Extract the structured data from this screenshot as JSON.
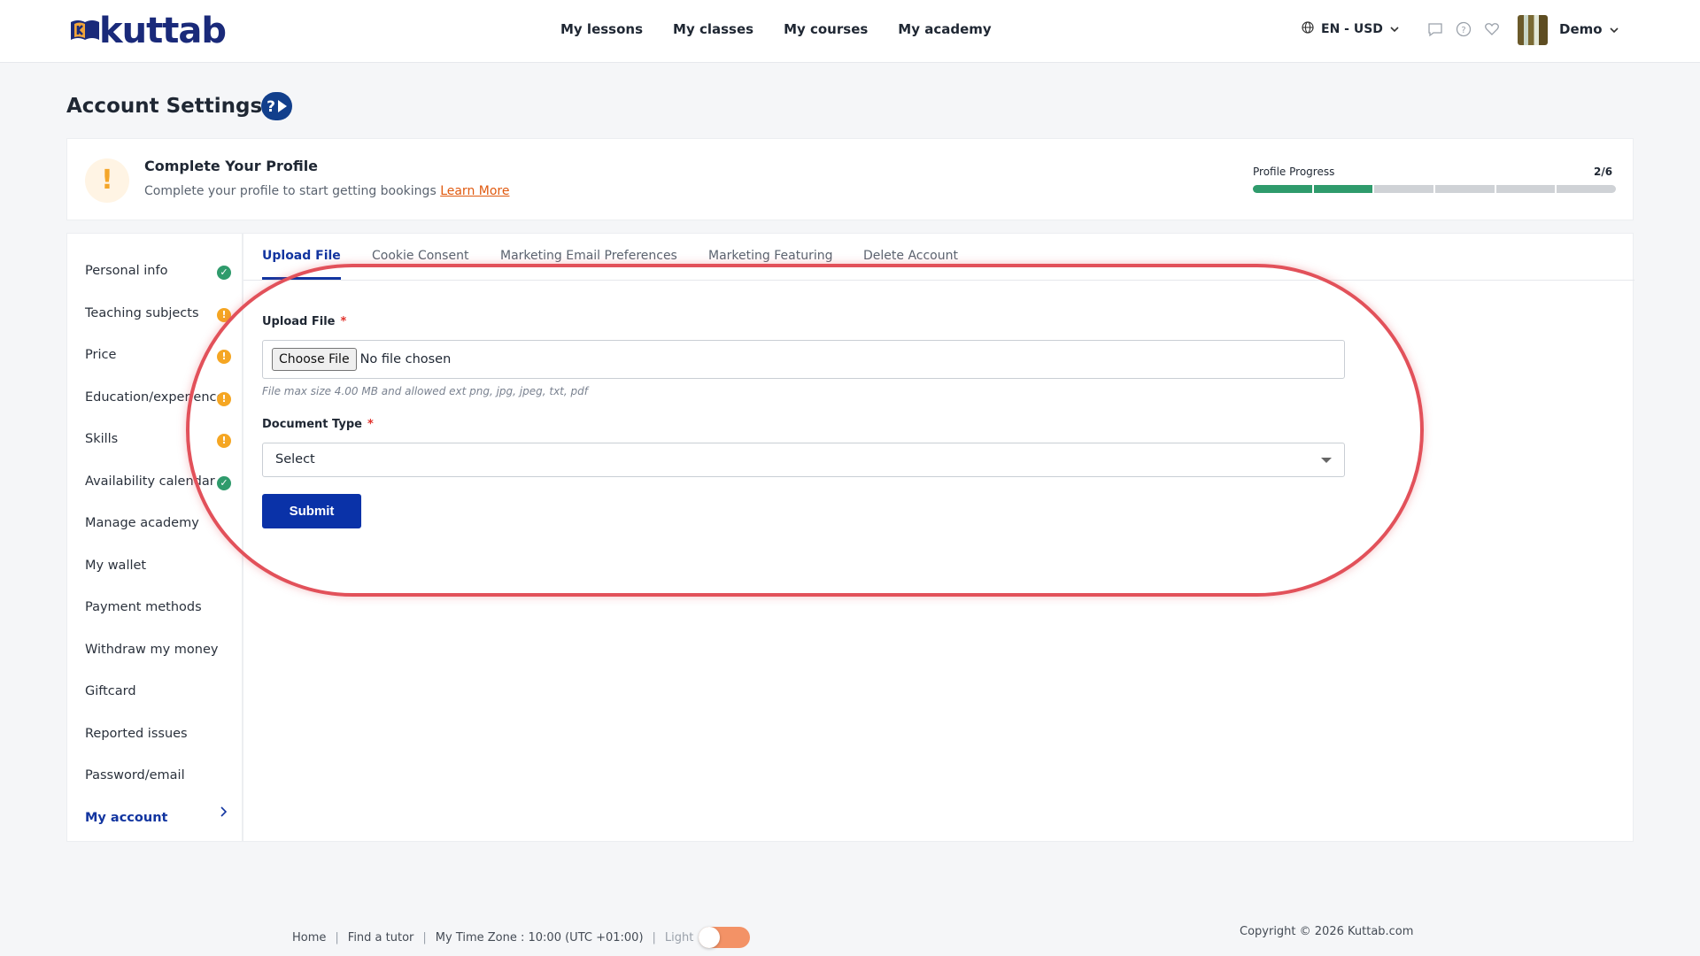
{
  "brand": {
    "name": "kuttab",
    "colors": {
      "primary": "#0a32a8",
      "accent": "#e05a10",
      "success": "#2f9b6c",
      "warning": "#f5a623",
      "annotation": "#e2515a"
    }
  },
  "nav": {
    "items": [
      "My lessons",
      "My classes",
      "My courses",
      "My academy"
    ]
  },
  "header": {
    "locale": "EN - USD",
    "user_name": "Demo",
    "icons": [
      "globe-icon",
      "chat-icon",
      "help-icon",
      "heart-icon",
      "chevron-down-icon"
    ]
  },
  "page": {
    "title": "Account Settings"
  },
  "profile": {
    "title": "Complete Your Profile",
    "description": "Complete your profile to start getting bookings",
    "learn_more": "Learn More",
    "progress_label": "Profile Progress",
    "progress_text": "2/6",
    "progress_completed": 2,
    "progress_total": 6
  },
  "sidebar": {
    "items": [
      {
        "label": "Personal info",
        "status": "ok"
      },
      {
        "label": "Teaching subjects",
        "status": "warn"
      },
      {
        "label": "Price",
        "status": "warn"
      },
      {
        "label": "Education/experience",
        "status": "warn"
      },
      {
        "label": "Skills",
        "status": "warn"
      },
      {
        "label": "Availability calendar",
        "status": "ok"
      },
      {
        "label": "Manage academy",
        "status": ""
      },
      {
        "label": "My wallet",
        "status": ""
      },
      {
        "label": "Payment methods",
        "status": ""
      },
      {
        "label": "Withdraw my money",
        "status": ""
      },
      {
        "label": "Giftcard",
        "status": ""
      },
      {
        "label": "Reported issues",
        "status": ""
      },
      {
        "label": "Password/email",
        "status": ""
      },
      {
        "label": "My account",
        "status": "",
        "active": true
      }
    ]
  },
  "tabs": [
    "Upload File",
    "Cookie Consent",
    "Marketing Email Preferences",
    "Marketing Featuring",
    "Delete Account"
  ],
  "form": {
    "upload_label": "Upload File",
    "required_mark": "*",
    "choose_button": "Choose File",
    "file_status": "No file chosen",
    "hint": "File max size 4.00 MB and allowed ext png, jpg, jpeg, txt, pdf",
    "doc_type_label": "Document Type",
    "doc_type_value": "Select",
    "submit_label": "Submit"
  },
  "footer": {
    "links": [
      "Home",
      "Find a tutor",
      "My Time Zone : 10:00 (UTC +01:00)"
    ],
    "theme_label": "Light",
    "copyright": "Copyright © 2026 Kuttab.com"
  }
}
